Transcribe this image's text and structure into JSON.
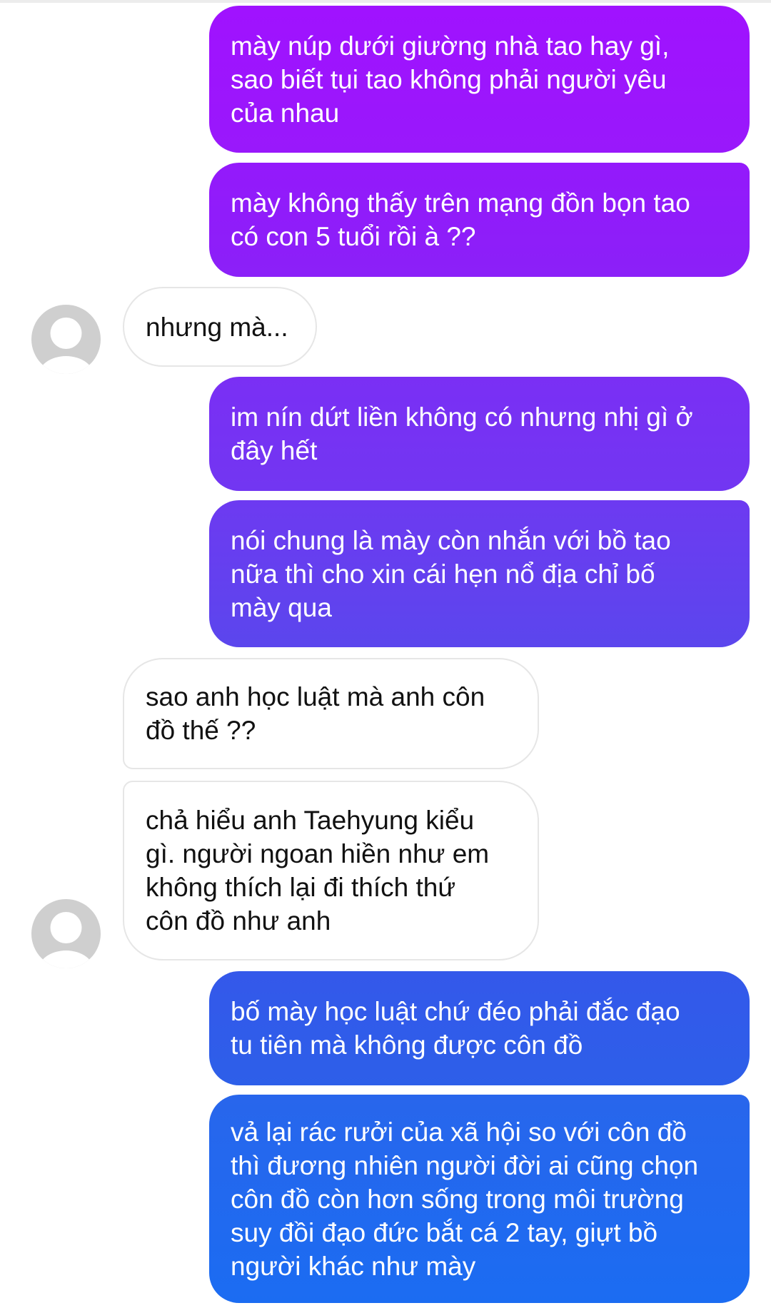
{
  "colors": {
    "sent_top": "#a012ff",
    "sent_bottom": "#1b6cf2",
    "received_bg": "#ffffff",
    "avatar_bg": "#cfcfcf"
  },
  "messages": [
    {
      "from": "me",
      "text": "mày núp dưới giường nhà tao hay gì,\nsao biết tụi tao không phải người yêu\ncủa nhau"
    },
    {
      "from": "me",
      "text": "mày không thấy trên mạng đồn bọn tao\ncó con 5 tuổi rồi à ??"
    },
    {
      "from": "them",
      "text": "nhưng mà..."
    },
    {
      "from": "me",
      "text": "im nín dứt liền không có nhưng nhị gì ở\nđây hết"
    },
    {
      "from": "me",
      "text": "nói chung là mày còn nhắn với bồ tao\nnữa thì cho xin cái hẹn nổ địa chỉ bố\nmày qua"
    },
    {
      "from": "them",
      "text": "sao anh học luật mà anh côn\nđồ thế ??"
    },
    {
      "from": "them",
      "text": "chả hiểu anh Taehyung kiểu\ngì. người ngoan hiền như em\nkhông thích lại đi thích thứ\ncôn đồ như anh"
    },
    {
      "from": "me",
      "text": "bố mày học luật chứ đéo phải đắc đạo\ntu tiên mà không được côn đồ"
    },
    {
      "from": "me",
      "text": "vả lại rác rưởi của xã hội so với côn đồ\nthì đương nhiên người đời ai cũng chọn\ncôn đồ còn hơn sống trong môi trường\nsuy đồi đạo đức bắt cá 2 tay, giựt bồ\nngười khác như mày"
    }
  ]
}
